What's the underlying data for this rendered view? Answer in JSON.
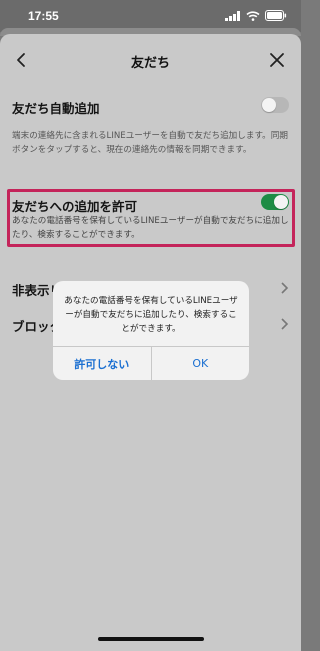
{
  "status_bar": {
    "time": "17:55"
  },
  "nav": {
    "title": "友だち"
  },
  "auto_add": {
    "title": "友だち自動追加",
    "description": "端末の連絡先に含まれるLINEユーザーを自動で友だち追加します。同期ボタンをタップすると、現在の連絡先の情報を同期できます。",
    "enabled": false
  },
  "allow_add": {
    "title": "友だちへの追加を許可",
    "description": "あなたの電話番号を保有しているLINEユーザーが自動で友だちに追加したり、検索することができます。",
    "enabled": true
  },
  "rows": {
    "hidden_list": "非表示リ",
    "block_list": "ブロック"
  },
  "dialog": {
    "message": "あなたの電話番号を保有しているLINEユーザーが自動で友だちに追加したり、検索することができます。",
    "cancel_label": "許可しない",
    "ok_label": "OK"
  },
  "colors": {
    "highlight": "#c4245a",
    "toggle_on": "#1e8c45",
    "dialog_button": "#1a6fd1"
  }
}
